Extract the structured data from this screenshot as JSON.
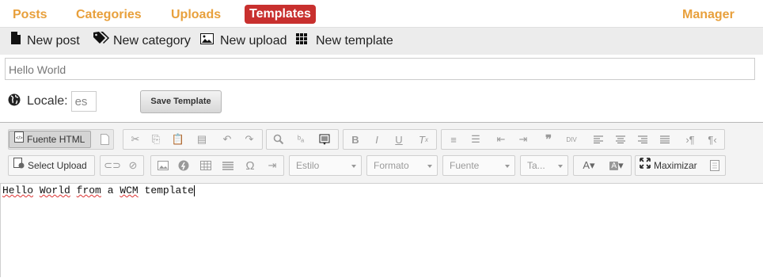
{
  "nav": {
    "items": [
      {
        "label": "Posts"
      },
      {
        "label": "Categories"
      },
      {
        "label": "Uploads"
      },
      {
        "label": "Templates",
        "active": true
      }
    ],
    "right_label": "Manager",
    "accent_color": "#e8a03c",
    "active_color": "#c8302e"
  },
  "actions": {
    "new_post": "New post",
    "new_category": "New category",
    "new_upload": "New upload",
    "new_template": "New template"
  },
  "form": {
    "title_value": "Hello World",
    "locale_label": "Locale:",
    "locale_value": "es",
    "save_label": "Save Template"
  },
  "editor": {
    "source_label": "Fuente HTML",
    "select_upload_label": "Select Upload",
    "style_placeholder": "Estilo",
    "format_placeholder": "Formato",
    "font_placeholder": "Fuente",
    "size_placeholder": "Ta...",
    "maximize_label": "Maximizar",
    "content_words": [
      "Hello",
      "World",
      "from",
      "a",
      "WCM",
      "template"
    ]
  }
}
